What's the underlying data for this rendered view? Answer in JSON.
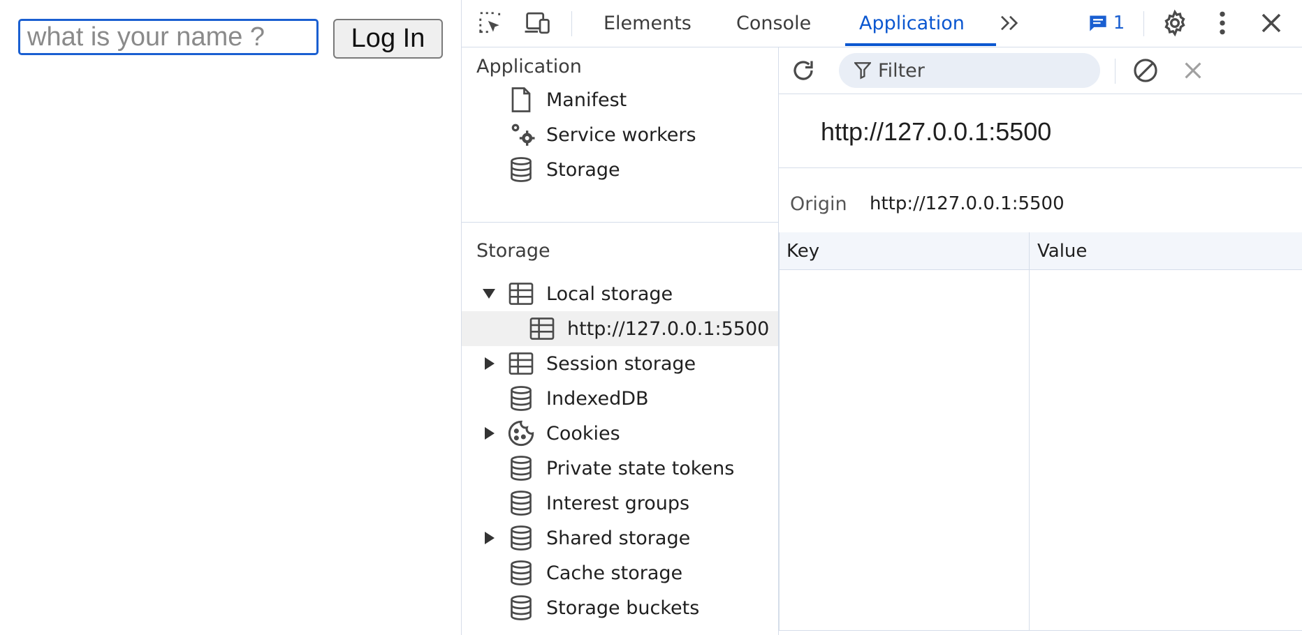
{
  "page": {
    "name_input": {
      "placeholder": "what is your name ?",
      "value": ""
    },
    "login_button": "Log In"
  },
  "devtools": {
    "tabs": [
      "Elements",
      "Console",
      "Application"
    ],
    "active_tab": "Application",
    "issues_count": "1",
    "accent_color": "#0b57d0",
    "sidebar": {
      "application_section": {
        "title": "Application",
        "items": [
          {
            "label": "Manifest",
            "icon": "document-icon"
          },
          {
            "label": "Service workers",
            "icon": "gears-icon"
          },
          {
            "label": "Storage",
            "icon": "database-icon"
          }
        ]
      },
      "storage_section": {
        "title": "Storage",
        "items": [
          {
            "label": "Local storage",
            "icon": "table-icon",
            "expanded": true
          },
          {
            "label": "http://127.0.0.1:5500",
            "icon": "table-icon",
            "selected": true
          },
          {
            "label": "Session storage",
            "icon": "table-icon",
            "expanded": false
          },
          {
            "label": "IndexedDB",
            "icon": "database-icon"
          },
          {
            "label": "Cookies",
            "icon": "cookie-icon",
            "expanded": false
          },
          {
            "label": "Private state tokens",
            "icon": "database-icon"
          },
          {
            "label": "Interest groups",
            "icon": "database-icon"
          },
          {
            "label": "Shared storage",
            "icon": "database-icon",
            "expanded": false
          },
          {
            "label": "Cache storage",
            "icon": "database-icon"
          },
          {
            "label": "Storage buckets",
            "icon": "database-icon"
          }
        ]
      }
    },
    "main": {
      "filter_placeholder": "Filter",
      "origin_heading": "http://127.0.0.1:5500",
      "origin_label": "Origin",
      "origin_value": "http://127.0.0.1:5500",
      "columns": [
        "Key",
        "Value"
      ]
    }
  }
}
